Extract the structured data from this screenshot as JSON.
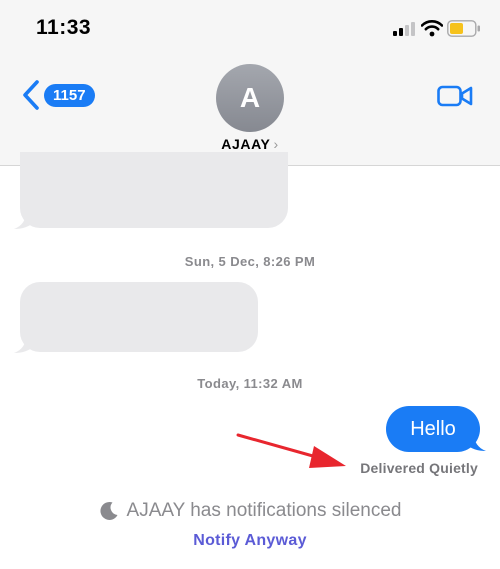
{
  "status_bar": {
    "time": "11:33"
  },
  "nav": {
    "back_count": "1157",
    "avatar_initial": "A",
    "contact_name": "AJAAY",
    "contact_chevron": "›"
  },
  "messages": {
    "timestamp_1": "Sun, 5 Dec, 8:26 PM",
    "timestamp_2": "Today, 11:32 AM",
    "outgoing_text": "Hello",
    "delivered_status": "Delivered Quietly"
  },
  "focus_notice": {
    "silenced_text": "AJAAY has notifications silenced",
    "notify_anyway_label": "Notify Anyway"
  },
  "colors": {
    "accent_blue": "#1a7cf5",
    "incoming_bubble": "#e9e9eb",
    "notify_purple": "#5b5bd6",
    "annotation_red": "#e8262e",
    "battery_yellow": "#f6c21c"
  },
  "icons": [
    "signal-icon",
    "wifi-icon",
    "battery-icon",
    "back-chevron-icon",
    "video-call-icon",
    "moon-icon",
    "annotation-arrow"
  ]
}
